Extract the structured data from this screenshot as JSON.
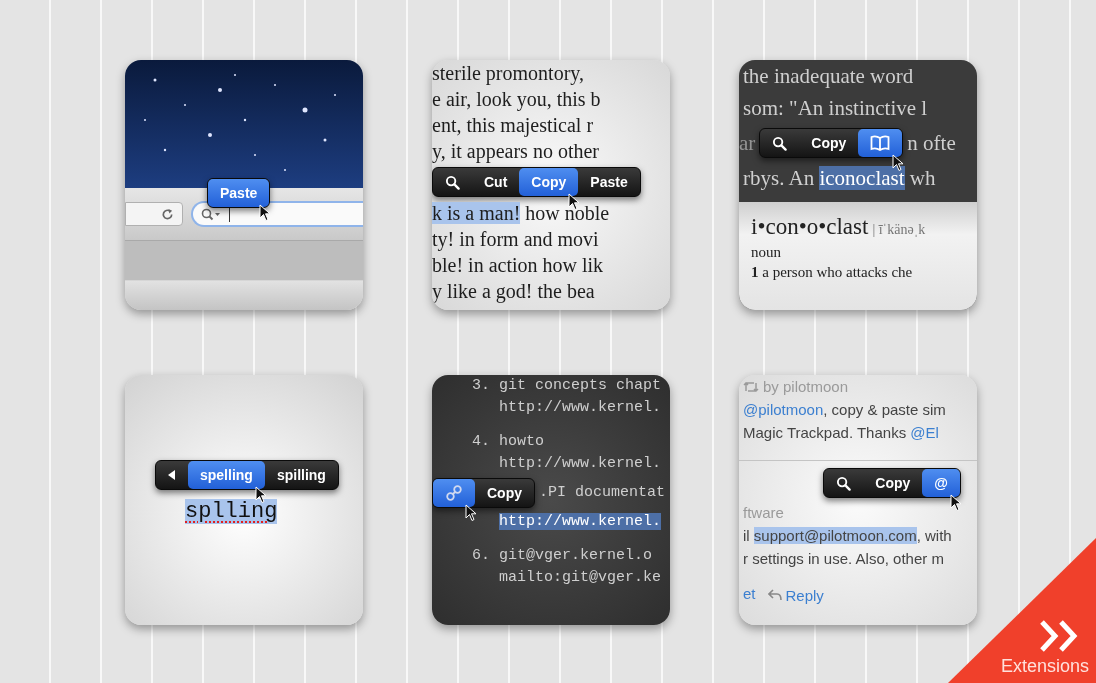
{
  "tiles": [
    {
      "kind": "browser",
      "popup": {
        "items": [
          {
            "kind": "text",
            "label": "Paste",
            "selected": true
          }
        ]
      }
    },
    {
      "kind": "book",
      "lines": [
        {
          "kind": "text",
          "parts": [
            {
              "text": "sterile promontory,",
              "kind": "plain"
            }
          ]
        },
        {
          "kind": "text",
          "parts": [
            {
              "text": "e air, look you, this b",
              "kind": "plain"
            }
          ]
        },
        {
          "kind": "text",
          "parts": [
            {
              "text": "ent, this majestical r",
              "kind": "plain"
            }
          ]
        },
        {
          "kind": "text",
          "parts": [
            {
              "text": "y, it appears no other",
              "kind": "plain"
            }
          ]
        },
        {
          "kind": "popup",
          "items": [
            {
              "kind": "search",
              "selected": false
            },
            {
              "kind": "text",
              "label": "Cut",
              "selected": false
            },
            {
              "kind": "text",
              "label": "Copy",
              "selected": true
            },
            {
              "kind": "text",
              "label": "Paste",
              "selected": false
            }
          ]
        },
        {
          "kind": "text",
          "parts": [
            {
              "text": "k is a man!",
              "kind": "selection"
            },
            {
              "text": " how noble",
              "kind": "plain"
            }
          ]
        },
        {
          "kind": "text",
          "parts": [
            {
              "text": "ty! in form and movi",
              "kind": "plain"
            }
          ]
        },
        {
          "kind": "text",
          "parts": [
            {
              "text": "ble! in action how lik",
              "kind": "plain"
            }
          ]
        },
        {
          "kind": "text",
          "parts": [
            {
              "text": "y like a god! the bea",
              "kind": "plain"
            }
          ]
        }
      ]
    },
    {
      "kind": "dictionary",
      "lines": [
        {
          "kind": "text",
          "parts": [
            {
              "text": "the inadequate word",
              "kind": "plain"
            }
          ]
        },
        {
          "kind": "text",
          "parts": [
            {
              "text": "som: \"An instinctive l",
              "kind": "plain"
            }
          ]
        },
        {
          "kind": "popup",
          "before": "ar",
          "after": "n ofte",
          "items": [
            {
              "kind": "search",
              "selected": false
            },
            {
              "kind": "text",
              "label": "Copy",
              "selected": false
            },
            {
              "kind": "book",
              "selected": true
            }
          ]
        },
        {
          "kind": "text",
          "parts": [
            {
              "text": "rbys. An ",
              "kind": "plain"
            },
            {
              "text": "iconoclast",
              "kind": "selection"
            },
            {
              "text": " wh",
              "kind": "plain"
            }
          ]
        }
      ],
      "definition": {
        "word": "i•con•o•clast",
        "pronunciation": "| īˈkänəˌk",
        "part_of_speech": "noun",
        "sense_number": "1",
        "sense": "a person who attacks che"
      }
    },
    {
      "kind": "spelling",
      "lines": [
        {
          "kind": "popup",
          "items": [
            {
              "kind": "back",
              "selected": false
            },
            {
              "kind": "text",
              "label": "spelling",
              "selected": true
            },
            {
              "kind": "text",
              "label": "spilling",
              "selected": false
            }
          ]
        },
        {
          "kind": "text",
          "parts": [
            {
              "text": "splling",
              "kind": "misspelled"
            }
          ]
        }
      ]
    },
    {
      "kind": "code",
      "lines": [
        {
          "kind": "text",
          "parts": [
            {
              "text": "3. git concepts chapt",
              "kind": "plain"
            }
          ]
        },
        {
          "kind": "continuation",
          "parts": [
            {
              "text": "http://www.kernel.",
              "kind": "plain"
            }
          ]
        },
        {
          "kind": "gap"
        },
        {
          "kind": "text",
          "parts": [
            {
              "text": "4. howto",
              "kind": "plain"
            }
          ]
        },
        {
          "kind": "continuation",
          "parts": [
            {
              "text": "http://www.kernel.",
              "kind": "plain"
            }
          ]
        },
        {
          "kind": "popup",
          "after": ".PI documentat",
          "items": [
            {
              "kind": "link",
              "selected": true
            },
            {
              "kind": "text",
              "label": "Copy",
              "selected": false
            }
          ]
        },
        {
          "kind": "continuation",
          "parts": [
            {
              "text": "http://www.kernel.",
              "kind": "selection"
            }
          ]
        },
        {
          "kind": "gap"
        },
        {
          "kind": "text",
          "parts": [
            {
              "text": "6. git@vger.kernel.o",
              "kind": "plain"
            }
          ]
        },
        {
          "kind": "continuation",
          "parts": [
            {
              "text": "mailto:git@vger.ke",
              "kind": "plain"
            }
          ]
        }
      ]
    },
    {
      "kind": "tweet",
      "lines": [
        {
          "kind": "byline",
          "parts": [
            {
              "text": "by pilotmoon",
              "kind": "muted"
            }
          ]
        },
        {
          "kind": "text",
          "parts": [
            {
              "text": "@pilotmoon",
              "kind": "link"
            },
            {
              "text": ", copy & paste sim",
              "kind": "plain"
            }
          ]
        },
        {
          "kind": "text",
          "parts": [
            {
              "text": "Magic Trackpad. Thanks ",
              "kind": "plain"
            },
            {
              "text": "@El",
              "kind": "link"
            }
          ]
        },
        {
          "kind": "gap"
        },
        {
          "kind": "divider"
        },
        {
          "kind": "popup",
          "items": [
            {
              "kind": "search",
              "selected": false
            },
            {
              "kind": "text",
              "label": "Copy",
              "selected": false
            },
            {
              "kind": "text",
              "label": "@",
              "selected": true
            }
          ]
        },
        {
          "kind": "text",
          "parts": [
            {
              "text": "ftware",
              "kind": "muted"
            }
          ]
        },
        {
          "kind": "text",
          "parts": [
            {
              "text": "il ",
              "kind": "plain"
            },
            {
              "text": "support@pilotmoon.com",
              "kind": "selection"
            },
            {
              "text": ", with",
              "kind": "plain"
            }
          ]
        },
        {
          "kind": "text",
          "parts": [
            {
              "text": "r settings in use. Also, other m",
              "kind": "plain"
            }
          ]
        },
        {
          "kind": "gap"
        },
        {
          "kind": "text",
          "parts": [
            {
              "text": "et",
              "kind": "link"
            },
            {
              "text": "Reply",
              "kind": "reply"
            }
          ]
        }
      ]
    }
  ],
  "corner": {
    "label": "Extensions"
  }
}
